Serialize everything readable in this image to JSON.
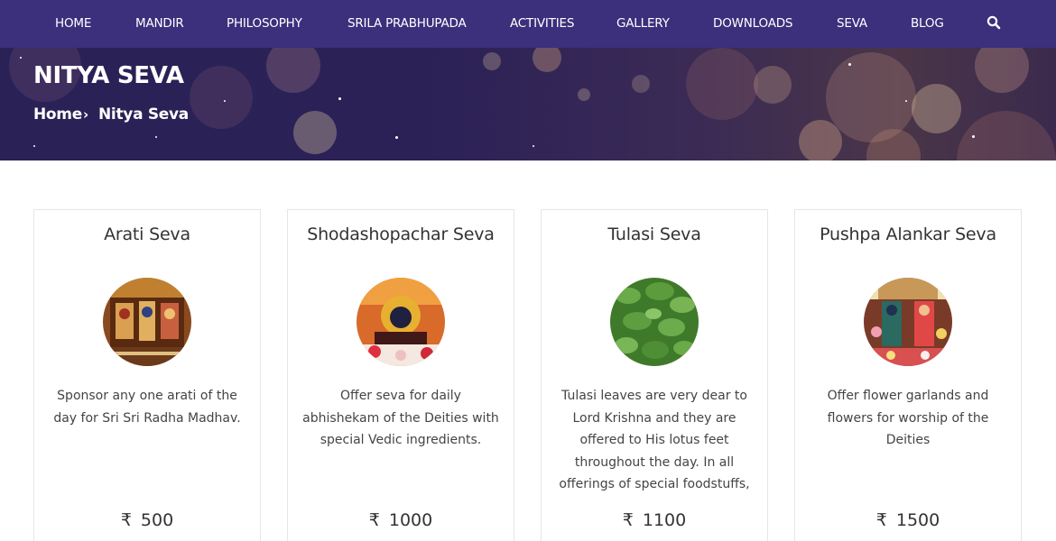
{
  "nav": {
    "items": [
      {
        "label": "HOME"
      },
      {
        "label": "MANDIR"
      },
      {
        "label": "PHILOSOPHY"
      },
      {
        "label": "SRILA PRABHUPADA"
      },
      {
        "label": "ACTIVITIES"
      },
      {
        "label": "GALLERY"
      },
      {
        "label": "DOWNLOADS"
      },
      {
        "label": "SEVA"
      },
      {
        "label": "BLOG"
      }
    ],
    "search_icon": "search-icon"
  },
  "banner": {
    "title": "NITYA SEVA",
    "breadcrumb": {
      "home": "Home",
      "separator": "›",
      "current": "Nitya Seva"
    }
  },
  "colors": {
    "nav_bg": "#3c2f7c",
    "banner_bg": "#2a2256"
  },
  "cards": [
    {
      "title": "Arati Seva",
      "description": "Sponsor any one arati of the day for Sri Sri Radha Madhav.",
      "currency": "₹",
      "price": "500"
    },
    {
      "title": "Shodashopachar Seva",
      "description": "Offer seva for daily abhishekam of the Deities with special Vedic ingredients.",
      "currency": "₹",
      "price": "1000"
    },
    {
      "title": "Tulasi Seva",
      "description": "Tulasi leaves are very dear to Lord Krishna and they are offered to His lotus feet throughout the day. In all offerings of special foodstuffs,",
      "currency": "₹",
      "price": "1100"
    },
    {
      "title": "Pushpa Alankar Seva",
      "description": "Offer flower garlands and flowers for worship of the Deities",
      "currency": "₹",
      "price": "1500"
    }
  ]
}
